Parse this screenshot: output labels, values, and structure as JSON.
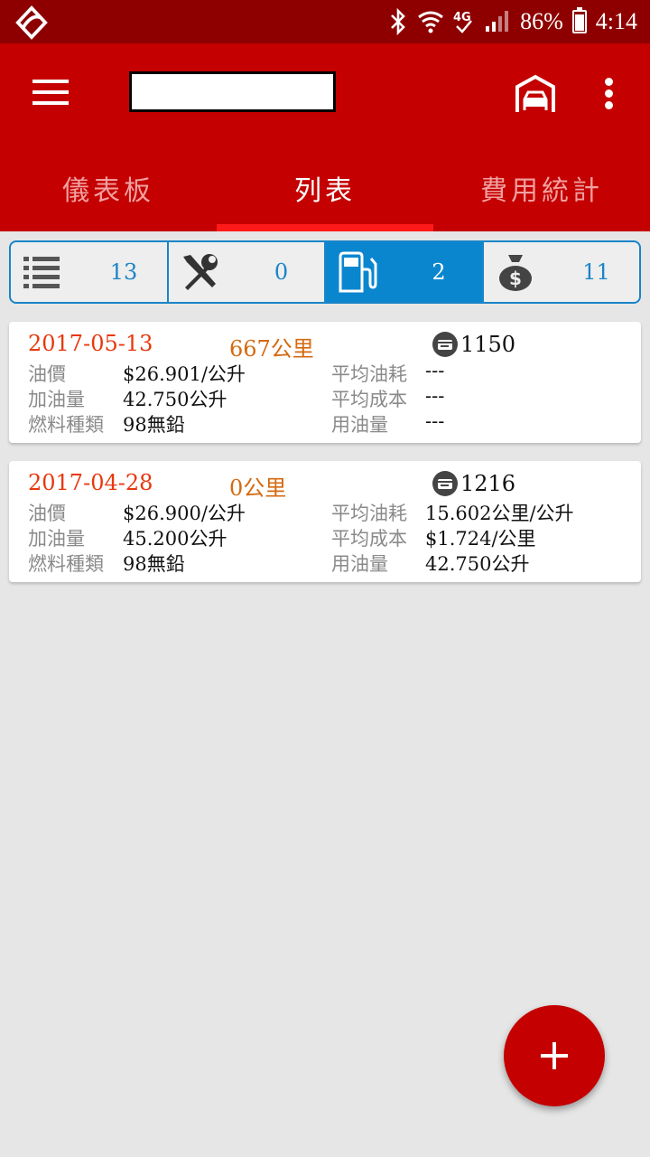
{
  "status_bar": {
    "battery": "86%",
    "time": "4:14",
    "network": "4G"
  },
  "tabs": [
    {
      "label": "儀表板",
      "active": false
    },
    {
      "label": "列表",
      "active": true
    },
    {
      "label": "費用統計",
      "active": false
    }
  ],
  "filter": [
    {
      "icon": "list-icon",
      "count": "13",
      "active": false
    },
    {
      "icon": "wrench-icon",
      "count": "0",
      "active": false
    },
    {
      "icon": "fuel-pump-icon",
      "count": "2",
      "active": true
    },
    {
      "icon": "money-bag-icon",
      "count": "11",
      "active": false
    }
  ],
  "labels": {
    "price": "油價",
    "volume": "加油量",
    "fuel_type": "燃料種類",
    "avg_consumption": "平均油耗",
    "avg_cost": "平均成本",
    "fuel_used": "用油量"
  },
  "records": [
    {
      "date": "2017-05-13",
      "odometer": "667公里",
      "receipt": "1150",
      "price": "$26.901/公升",
      "volume": "42.750公升",
      "fuel_type": "98無鉛",
      "avg_consumption": "---",
      "avg_cost": "---",
      "fuel_used": "---"
    },
    {
      "date": "2017-04-28",
      "odometer": "0公里",
      "receipt": "1216",
      "price": "$26.900/公升",
      "volume": "45.200公升",
      "fuel_type": "98無鉛",
      "avg_consumption": "15.602公里/公升",
      "avg_cost": "$1.724/公里",
      "fuel_used": "42.750公升"
    }
  ],
  "colors": {
    "status_bar": "#8e0000",
    "app_bar": "#c40000",
    "accent_blue": "#0a86cf",
    "date_red": "#e8380d",
    "odometer_orange": "#d46a10"
  }
}
